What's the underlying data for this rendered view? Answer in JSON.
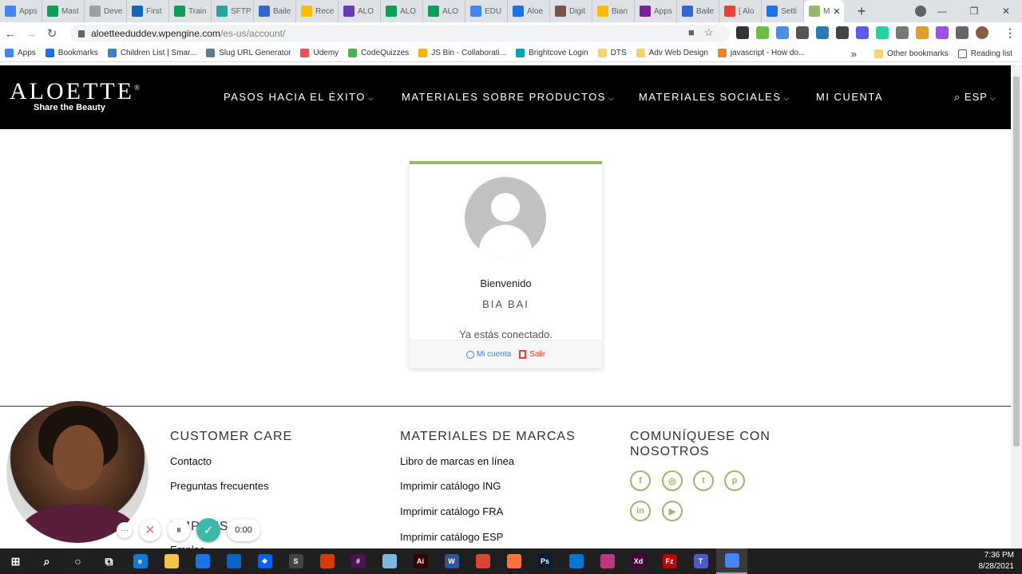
{
  "browser": {
    "tabs": [
      {
        "label": "Apps",
        "color": "#4285f4",
        "icon": "apps-grid-icon"
      },
      {
        "label": "Mast",
        "color": "#0f9d58",
        "icon": "sheets-icon"
      },
      {
        "label": "Deve",
        "color": "#9aa0a6",
        "icon": "page-icon"
      },
      {
        "label": "First",
        "color": "#1565c0",
        "icon": "trello-icon"
      },
      {
        "label": "Train",
        "color": "#0f9d58",
        "icon": "sheets-icon"
      },
      {
        "label": "SFTP",
        "color": "#26a69a",
        "icon": "table-icon"
      },
      {
        "label": "Baile",
        "color": "#3367d6",
        "icon": "calendar-icon"
      },
      {
        "label": "Rece",
        "color": "#fbbc04",
        "icon": "drive-icon"
      },
      {
        "label": "ALO",
        "color": "#673ab7",
        "icon": "forms-icon"
      },
      {
        "label": "ALO",
        "color": "#0f9d58",
        "icon": "sheets-icon"
      },
      {
        "label": "ALO",
        "color": "#0f9d58",
        "icon": "sheets-icon"
      },
      {
        "label": "EDU",
        "color": "#4285f4",
        "icon": "docs-icon"
      },
      {
        "label": "Aloe",
        "color": "#1a73e8",
        "icon": "shield-icon"
      },
      {
        "label": "Digit",
        "color": "#795548",
        "icon": "bag-icon"
      },
      {
        "label": "Bian",
        "color": "#fbbc04",
        "icon": "drive-icon"
      },
      {
        "label": "Apps",
        "color": "#7b1fa2",
        "icon": "b-icon"
      },
      {
        "label": "Baile",
        "color": "#3367d6",
        "icon": "calendar-icon"
      },
      {
        "label": "[ Alo",
        "color": "#ea4335",
        "icon": "gmail-icon"
      },
      {
        "label": "Setti",
        "color": "#1a73e8",
        "icon": "gear-icon"
      },
      {
        "label": "M",
        "color": "#98b86b",
        "icon": "aloette-icon",
        "active": true
      }
    ],
    "new_tab": "+",
    "url_host": "aloetteeduddev.wpengine.com",
    "url_path": "/es-us/account/",
    "bookmarks": [
      {
        "label": "Apps",
        "color": "#4285f4"
      },
      {
        "label": "Bookmarks",
        "color": "#1a73e8"
      },
      {
        "label": "Children List | Smar...",
        "color": "#3b7fc4"
      },
      {
        "label": "Slug URL Generator",
        "color": "#607d8b"
      },
      {
        "label": "Udemy",
        "color": "#ec5252"
      },
      {
        "label": "CodeQuizzes",
        "color": "#4caf50"
      },
      {
        "label": "JS Bin - Collaborati...",
        "color": "#f4b400"
      },
      {
        "label": "Brightcove Login",
        "color": "#00a6b4"
      },
      {
        "label": "DTS",
        "color": "#f9d36a"
      },
      {
        "label": "Adv Web Design",
        "color": "#f9d36a"
      },
      {
        "label": "javascript - How do...",
        "color": "#f48024"
      }
    ],
    "bookmarks_more": "»",
    "other_bookmarks": "Other bookmarks",
    "reading_list": "Reading list"
  },
  "site": {
    "logo": "ALOETTE",
    "logo_mark": "®",
    "tagline": "Share the Beauty",
    "nav": [
      {
        "label": "PASOS HACIA EL ÉXITO",
        "has_menu": true
      },
      {
        "label": "MATERIALES SOBRE PRODUCTOS",
        "has_menu": true
      },
      {
        "label": "MATERIALES SOCIALES",
        "has_menu": true
      },
      {
        "label": "MI CUENTA",
        "has_menu": false
      }
    ],
    "language": "ESP",
    "accent": "#98b86b"
  },
  "card": {
    "welcome": "Bienvenido",
    "username": "BIA BAI",
    "status": "Ya estás conectado.",
    "account_link": "Mi cuenta",
    "logout_link": "Salir"
  },
  "footer": {
    "col1_title": "CUSTOMER CARE",
    "col1_links": [
      "Contacto",
      "Preguntas frecuentes"
    ],
    "col1_partial": "EMPRESA",
    "col1_partial2": "Empleo",
    "col2_title": "MATERIALES DE MARCAS",
    "col2_links": [
      "Libro de marcas en línea",
      "Imprimir catálogo ING",
      "Imprimir catálogo FRA",
      "Imprimir catálogo ESP"
    ],
    "col3_title_line1": "COMUNÍQUESE CON",
    "col3_title_line2": "NOSOTROS",
    "social": [
      {
        "name": "facebook",
        "glyph": "f"
      },
      {
        "name": "instagram",
        "glyph": "◎"
      },
      {
        "name": "twitter",
        "glyph": "t"
      },
      {
        "name": "pinterest",
        "glyph": "p"
      },
      {
        "name": "linkedin",
        "glyph": "in"
      },
      {
        "name": "youtube",
        "glyph": "▶"
      }
    ]
  },
  "recorder": {
    "time": "0:00",
    "more": "···",
    "cancel": "✕",
    "pause": "⏸",
    "done": "✓"
  },
  "taskbar": {
    "apps": [
      {
        "name": "windows-start",
        "label": "⊞",
        "color": "#1f1f1f"
      },
      {
        "name": "search",
        "label": "⌕",
        "color": "#1f1f1f"
      },
      {
        "name": "cortana",
        "label": "○",
        "color": "#1f1f1f"
      },
      {
        "name": "task-view",
        "label": "⧉",
        "color": "#1f1f1f"
      },
      {
        "name": "edge",
        "label": "e",
        "color": "#0c7ad6"
      },
      {
        "name": "file-explorer",
        "label": "",
        "color": "#f4c542"
      },
      {
        "name": "store",
        "label": "",
        "color": "#1a73e8"
      },
      {
        "name": "mail",
        "label": "",
        "color": "#0a64c8"
      },
      {
        "name": "dropbox",
        "label": "❖",
        "color": "#0061ff"
      },
      {
        "name": "app-s",
        "label": "S",
        "color": "#444"
      },
      {
        "name": "office",
        "label": "",
        "color": "#d83b01"
      },
      {
        "name": "slack",
        "label": "#",
        "color": "#4a154b"
      },
      {
        "name": "app-blue",
        "label": "",
        "color": "#7ab8e0"
      },
      {
        "name": "illustrator",
        "label": "Ai",
        "color": "#330000"
      },
      {
        "name": "word",
        "label": "W",
        "color": "#2b579a"
      },
      {
        "name": "chrome-alt",
        "label": "",
        "color": "#db4437"
      },
      {
        "name": "firefox",
        "label": "",
        "color": "#ff7139"
      },
      {
        "name": "photoshop",
        "label": "Ps",
        "color": "#001e36"
      },
      {
        "name": "photos",
        "label": "",
        "color": "#0078d4"
      },
      {
        "name": "app-camera",
        "label": "",
        "color": "#c13584"
      },
      {
        "name": "xd",
        "label": "Xd",
        "color": "#470137"
      },
      {
        "name": "filezilla",
        "label": "Fz",
        "color": "#bf0000"
      },
      {
        "name": "teams",
        "label": "T",
        "color": "#5059c9"
      },
      {
        "name": "chrome",
        "label": "",
        "color": "#4285f4",
        "active": true
      }
    ],
    "time": "7:36 PM",
    "date": "8/28/2021"
  }
}
